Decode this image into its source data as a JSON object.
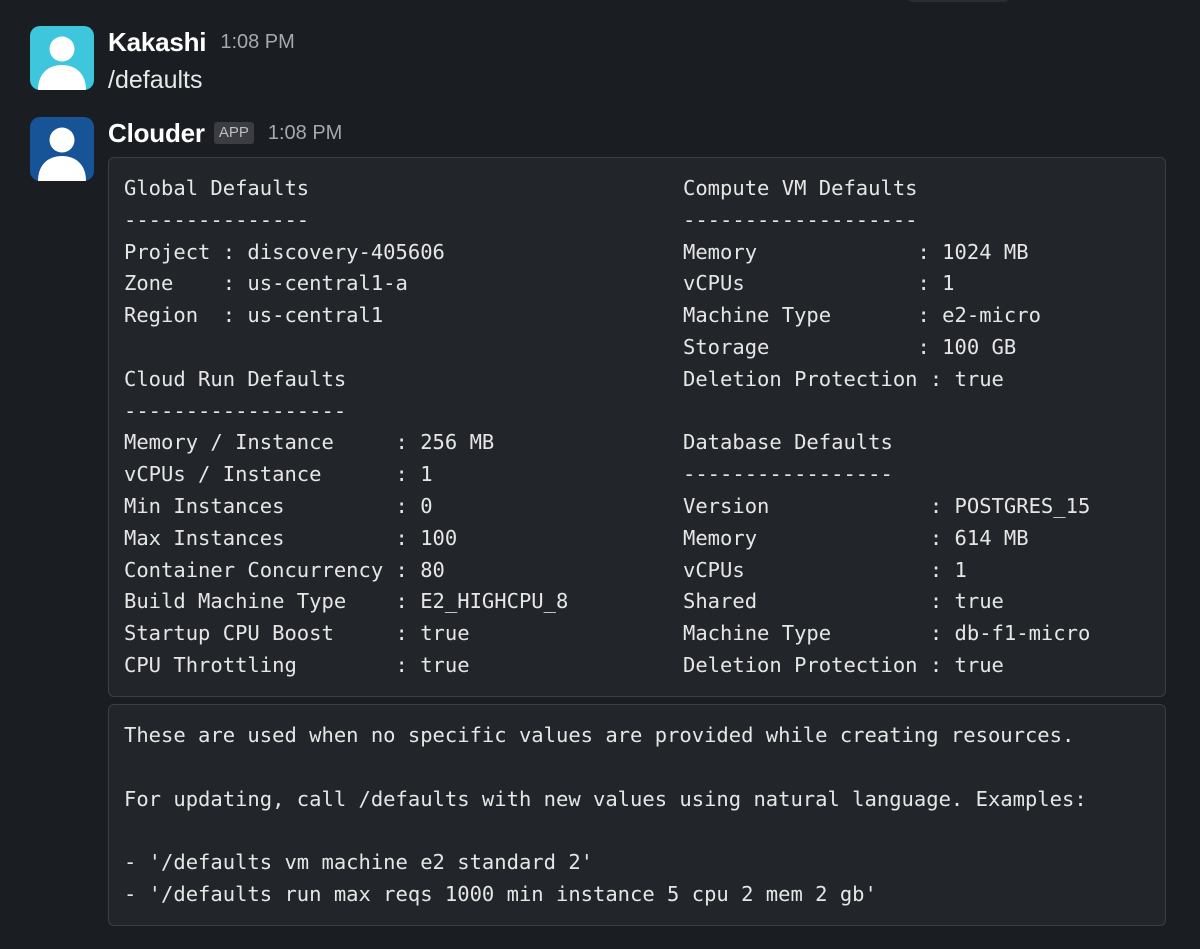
{
  "messages": [
    {
      "sender": "Kakashi",
      "time": "1:08 PM",
      "text": "/defaults",
      "avatar_color": "#3ec6dc"
    },
    {
      "sender": "Clouder",
      "badge": "APP",
      "time": "1:08 PM",
      "avatar_color": "#165397",
      "block1": {
        "left_column": "Global Defaults\n---------------\nProject : discovery-405606\nZone    : us-central1-a\nRegion  : us-central1\n\nCloud Run Defaults\n------------------\nMemory / Instance     : 256 MB\nvCPUs / Instance      : 1\nMin Instances         : 0\nMax Instances         : 100\nContainer Concurrency : 80\nBuild Machine Type    : E2_HIGHCPU_8\nStartup CPU Boost     : true\nCPU Throttling        : true",
        "right_column": "Compute VM Defaults\n-------------------\nMemory             : 1024 MB\nvCPUs              : 1\nMachine Type       : e2-micro\nStorage            : 100 GB\nDeletion Protection : true\n\nDatabase Defaults\n-----------------\nVersion             : POSTGRES_15\nMemory              : 614 MB\nvCPUs               : 1\nShared              : true\nMachine Type        : db-f1-micro\nDeletion Protection : true"
      },
      "block2": "These are used when no specific values are provided while creating resources.\n\nFor updating, call /defaults with new values using natural language. Examples:\n\n- '/defaults vm machine e2 standard 2'\n- '/defaults run max reqs 1000 min instance 5 cpu 2 mem 2 gb'"
    }
  ]
}
